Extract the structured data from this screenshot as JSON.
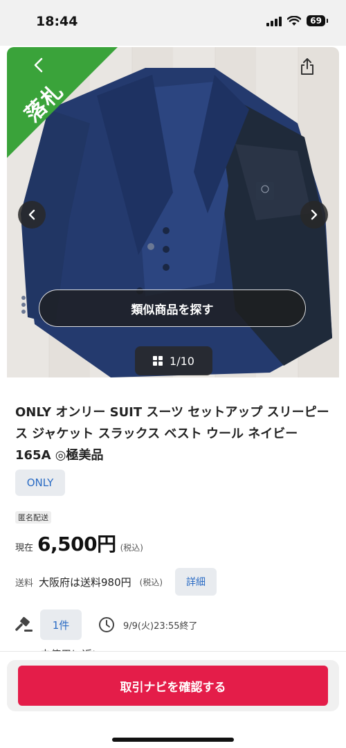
{
  "status_bar": {
    "time": "18:44",
    "battery": "69"
  },
  "hero": {
    "sold_label": "落札",
    "find_similar_label": "類似商品を探す",
    "counter_label": "1/10"
  },
  "item": {
    "title": "ONLY オンリー SUIT スーツ セットアップ スリーピース ジャケット スラックス ベスト ウール ネイビー 165A ◎極美品",
    "brand": "ONLY",
    "anonymous_shipping": "匿名配送",
    "price_label": "現在",
    "price_value": "6,500円",
    "price_tax": "(税込)",
    "shipping_label": "送料",
    "shipping_value": "大阪府は送料980円",
    "shipping_tax": "(税込)",
    "shipping_detail_label": "詳細",
    "bid_count": "1件",
    "end_time": "9/9(火)23:55終了",
    "condition_peek": "未使用に近い"
  },
  "bottom": {
    "confirm_label": "取引ナビを確認する"
  },
  "colors": {
    "sold_green": "#3aa33a",
    "primary_red": "#e41d49",
    "link_blue": "#2a6bc4"
  },
  "icons": [
    "back-icon",
    "share-icon",
    "chevron-left-icon",
    "chevron-right-icon",
    "grid-icon",
    "gavel-icon",
    "clock-icon",
    "wifi-icon",
    "signal-icon",
    "battery-icon"
  ]
}
